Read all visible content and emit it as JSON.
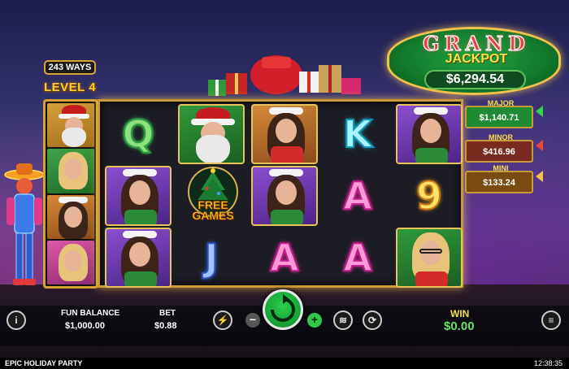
{
  "game": {
    "title": "EPIC HOLIDAY PARTY",
    "clock": "12:38:35",
    "ways": "243 WAYS",
    "level": "LEVEL 4"
  },
  "jackpots": {
    "grand_word": "GRAND",
    "jackpot_word": "JACKPOT",
    "grand_amount": "$6,294.54",
    "major": {
      "label": "MAJOR",
      "amount": "$1,140.71",
      "color": "#1f8a34"
    },
    "minor": {
      "label": "MINOR",
      "amount": "$416.96",
      "color": "#7a2a1e"
    },
    "mini": {
      "label": "MINI",
      "amount": "$133.24",
      "color": "#7a4b10"
    }
  },
  "reels": {
    "free_games_line1": "FREE",
    "free_games_line2": "GAMES",
    "symbols": {
      "r1c1": "Q",
      "r1c4": "K",
      "r2c5": "9",
      "r2c4": "A",
      "r3c2": "J",
      "r3c3": "A",
      "r3c4": "A"
    }
  },
  "controls": {
    "info": "i",
    "fun_balance_label": "FUN BALANCE",
    "fun_balance_value": "$1,000.00",
    "bet_label": "BET",
    "bet_value": "$0.88",
    "win_label": "WIN",
    "win_value": "$0.00",
    "menu": "≡",
    "turbo_icon": "lightning-icon",
    "minus": "−",
    "plus": "+",
    "autoplay_icon": "coin-stack-icon",
    "spin_icon": "refresh-arrow-icon"
  }
}
